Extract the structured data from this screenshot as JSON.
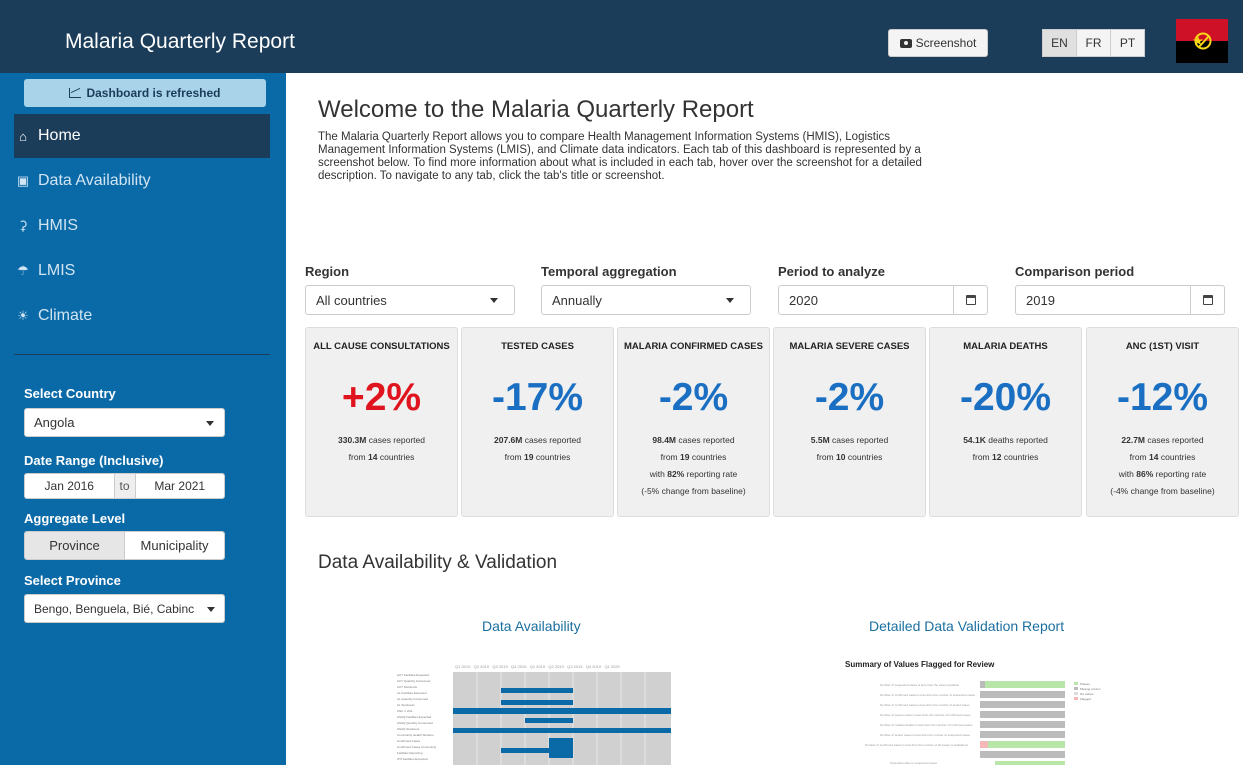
{
  "header": {
    "title": "Malaria Quarterly Report",
    "screenshot_label": "Screenshot",
    "languages": [
      "EN",
      "FR",
      "PT"
    ],
    "active_language": "EN"
  },
  "sidebar": {
    "refresh_label": "Dashboard is refreshed",
    "nav": [
      {
        "label": "Home",
        "icon": "home-icon"
      },
      {
        "label": "Data Availability",
        "icon": "database-icon"
      },
      {
        "label": "HMIS",
        "icon": "microscope-icon"
      },
      {
        "label": "LMIS",
        "icon": "parachute-icon"
      },
      {
        "label": "Climate",
        "icon": "sun-icon"
      }
    ],
    "select_country_label": "Select Country",
    "country": "Angola",
    "date_range_label": "Date Range (Inclusive)",
    "date_from": "Jan 2016",
    "date_to_sep": "to",
    "date_to": "Mar 2021",
    "aggregate_label": "Aggregate Level",
    "aggregate_options": [
      "Province",
      "Municipality"
    ],
    "select_province_label": "Select Province",
    "province": "Bengo, Benguela, Bié, Cabinc"
  },
  "main": {
    "welcome_title": "Welcome to the Malaria Quarterly Report",
    "welcome_text": "The Malaria Quarterly Report allows you to compare Health Management Information Systems (HMIS), Logistics Management Information Systems (LMIS), and Climate data indicators. Each tab of this dashboard is represented by a screenshot below. To find more information about what is included in each tab, hover over the screenshot for a detailed description. To navigate to any tab, click the tab's title or screenshot.",
    "filters": {
      "region_label": "Region",
      "region": "All countries",
      "temporal_label": "Temporal aggregation",
      "temporal": "Annually",
      "period_label": "Period to analyze",
      "period": "2020",
      "comparison_label": "Comparison period",
      "comparison": "2019"
    },
    "cards": [
      {
        "title": "ALL CAUSE CONSULTATIONS",
        "pct": "+2%",
        "l1b": "330.3M",
        "l1": " cases reported",
        "l2a": "from ",
        "l2b": "14",
        "l2c": " countries",
        "l3a": "",
        "l3b": "",
        "l3c": "",
        "l4": ""
      },
      {
        "title": "TESTED CASES",
        "pct": "-17%",
        "l1b": "207.6M",
        "l1": " cases reported",
        "l2a": "from ",
        "l2b": "19",
        "l2c": " countries",
        "l3a": "",
        "l3b": "",
        "l3c": "",
        "l4": ""
      },
      {
        "title": "MALARIA CONFIRMED CASES",
        "pct": "-2%",
        "l1b": "98.4M",
        "l1": " cases reported",
        "l2a": "from ",
        "l2b": "19",
        "l2c": " countries",
        "l3a": "with ",
        "l3b": "82%",
        "l3c": " reporting rate",
        "l4": "(-5% change from baseline)"
      },
      {
        "title": "MALARIA SEVERE CASES",
        "pct": "-2%",
        "l1b": "5.5M",
        "l1": " cases reported",
        "l2a": "from ",
        "l2b": "10",
        "l2c": " countries",
        "l3a": "",
        "l3b": "",
        "l3c": "",
        "l4": ""
      },
      {
        "title": "MALARIA DEATHS",
        "pct": "-20%",
        "l1b": "54.1K",
        "l1": " deaths reported",
        "l2a": "from ",
        "l2b": "12",
        "l2c": " countries",
        "l3a": "",
        "l3b": "",
        "l3c": "",
        "l4": ""
      },
      {
        "title": "ANC (1ST) VISIT",
        "pct": "-12%",
        "l1b": "22.7M",
        "l1": " cases reported",
        "l2a": "from ",
        "l2b": "14",
        "l2c": " countries",
        "l3a": "with ",
        "l3b": "86%",
        "l3c": " reporting rate",
        "l4": "(-4% change from baseline)"
      }
    ],
    "section_title": "Data Availability & Validation",
    "link_availability": "Data Availability",
    "link_validation": "Detailed Data Validation Report",
    "validation_thumb_title": "Summary of Values Flagged for Review"
  },
  "colors": {
    "header_bg": "#1c3d5a",
    "sidebar_bg": "#0a6aa8",
    "negative": "#1b6fc2",
    "positive": "#e0141e"
  }
}
